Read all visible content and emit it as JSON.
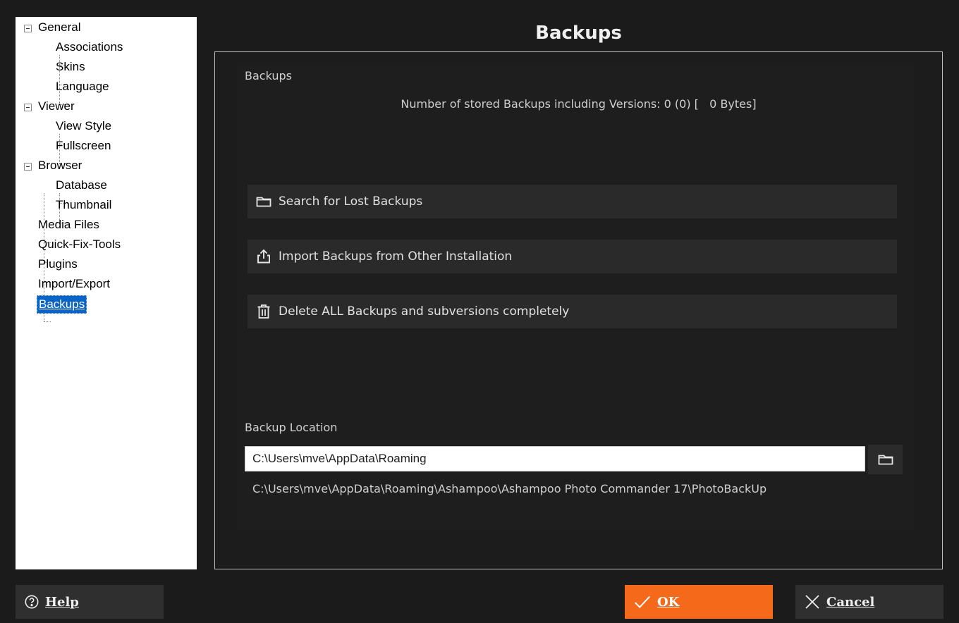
{
  "window": {
    "title": "Backups"
  },
  "tree": {
    "items": [
      {
        "label": "General"
      },
      {
        "label": "Associations"
      },
      {
        "label": "Skins"
      },
      {
        "label": "Language"
      },
      {
        "label": "Viewer"
      },
      {
        "label": "View Style"
      },
      {
        "label": "Fullscreen"
      },
      {
        "label": "Browser"
      },
      {
        "label": "Database"
      },
      {
        "label": "Thumbnail"
      },
      {
        "label": "Media Files"
      },
      {
        "label": "Quick-Fix-Tools"
      },
      {
        "label": "Plugins"
      },
      {
        "label": "Import/Export"
      },
      {
        "label": "Backups",
        "selected": true
      }
    ]
  },
  "backups": {
    "section_label": "Backups",
    "stats": "Number of stored Backups including Versions: 0 (0) [   0 Bytes]",
    "search_button": "Search for Lost Backups",
    "import_button": "Import Backups from Other Installation",
    "delete_button": "Delete ALL Backups and subversions completely"
  },
  "location": {
    "section_label": "Backup Location",
    "path_value": "C:\\Users\\mve\\AppData\\Roaming",
    "full_path": "C:\\Users\\mve\\AppData\\Roaming\\Ashampoo\\Ashampoo Photo Commander 17\\PhotoBackUp"
  },
  "footer": {
    "help_label": "Help",
    "ok_label": "OK",
    "cancel_label": "Cancel"
  },
  "colors": {
    "accent": "#f46a1a",
    "selection": "#0a64c8",
    "background": "#1b1b1b"
  }
}
